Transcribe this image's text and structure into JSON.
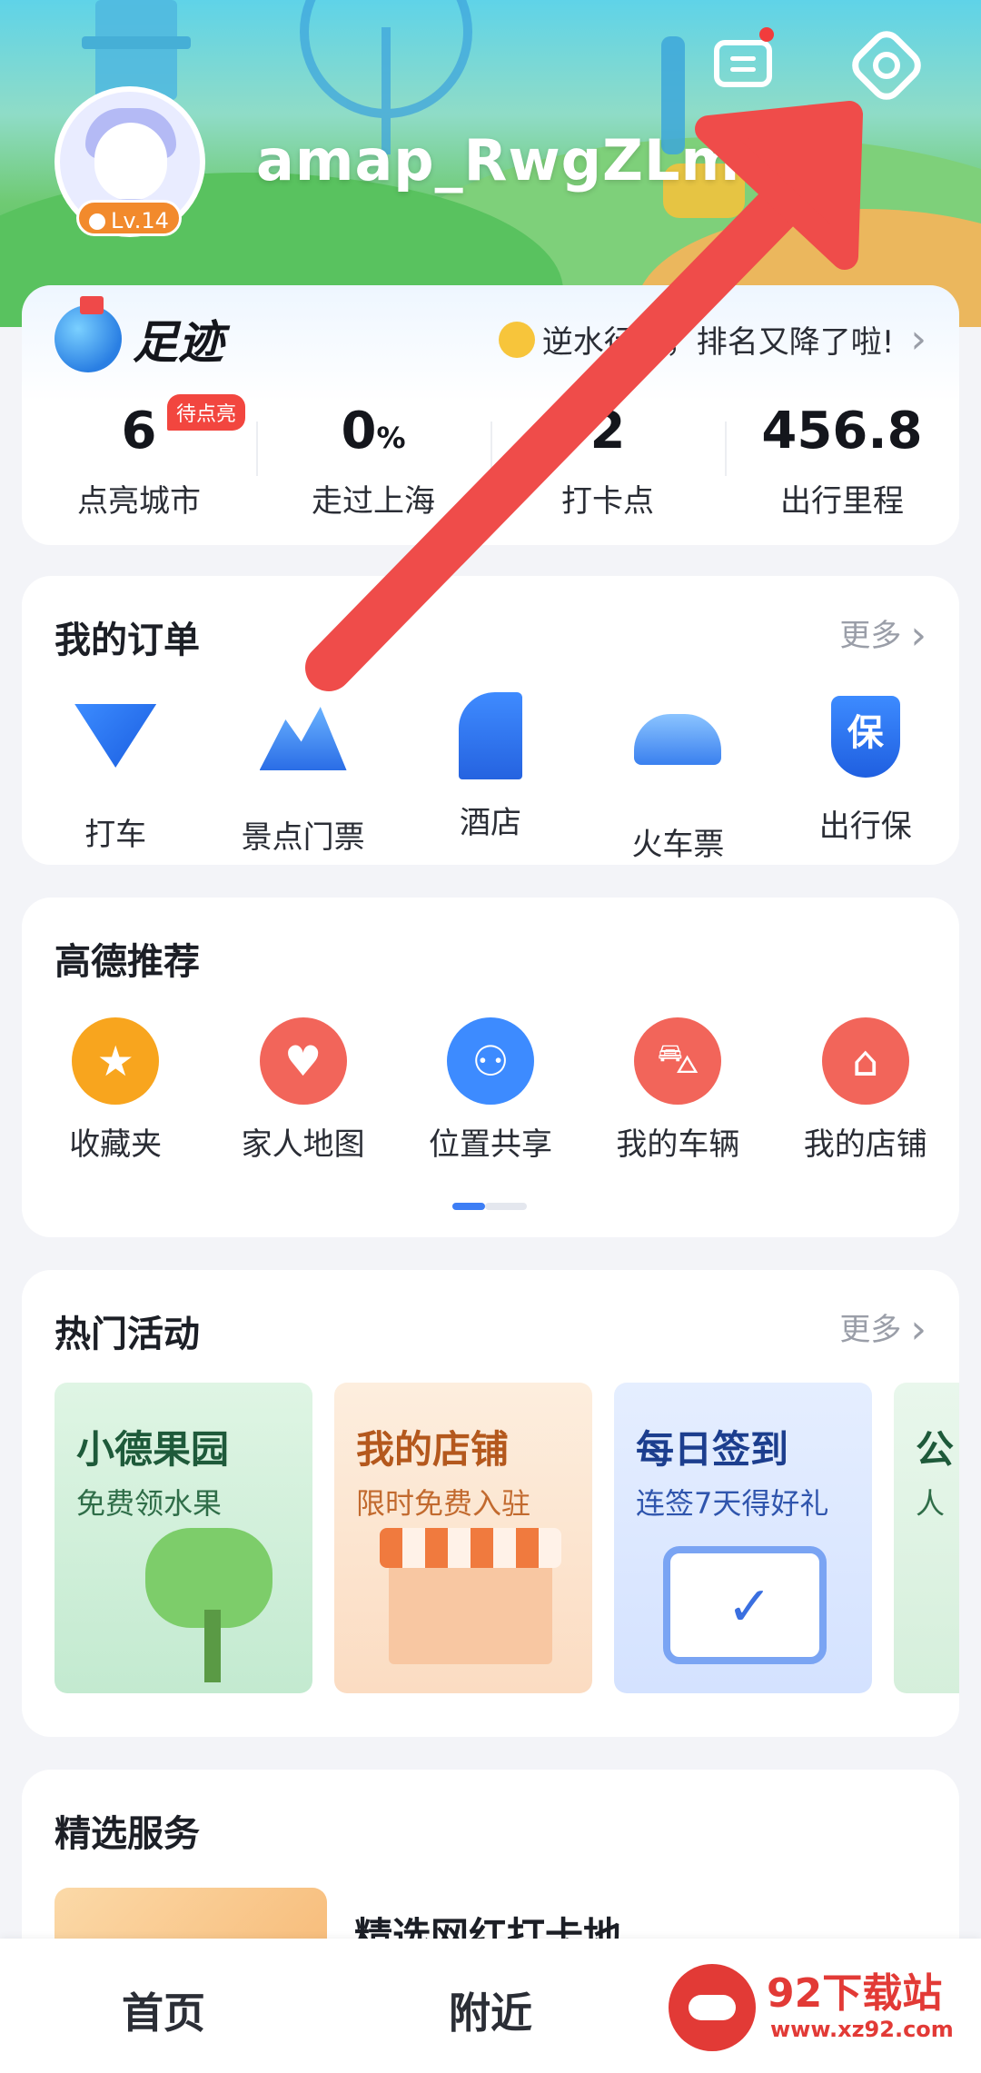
{
  "header": {
    "username": "amap_RwgZLme",
    "level": "Lv.14"
  },
  "footprint": {
    "title": "足迹",
    "notice": "逆水行舟，排名又降了啦!",
    "stats": [
      {
        "value": "6",
        "unit": "",
        "label": "点亮城市",
        "badge": "待点亮"
      },
      {
        "value": "0",
        "unit": "%",
        "label": "走过上海",
        "badge": ""
      },
      {
        "value": "2",
        "unit": "",
        "label": "打卡点",
        "badge": ""
      },
      {
        "value": "456.8",
        "unit": "",
        "label": "出行里程",
        "badge": ""
      }
    ]
  },
  "orders": {
    "title": "我的订单",
    "more": "更多",
    "items": [
      {
        "label": "打车",
        "icon": "taxi-icon"
      },
      {
        "label": "景点门票",
        "icon": "scenic-ticket-icon"
      },
      {
        "label": "酒店",
        "icon": "hotel-icon"
      },
      {
        "label": "火车票",
        "icon": "train-icon"
      },
      {
        "label": "出行保",
        "icon": "insurance-shield-icon",
        "glyph": "保"
      }
    ]
  },
  "recommend": {
    "title": "高德推荐",
    "items": [
      {
        "label": "收藏夹",
        "icon": "star-icon",
        "glyph": "★"
      },
      {
        "label": "家人地图",
        "icon": "family-map-icon",
        "glyph": "♥"
      },
      {
        "label": "位置共享",
        "icon": "location-share-icon",
        "glyph": "⚇"
      },
      {
        "label": "我的车辆",
        "icon": "vehicle-icon",
        "glyph": "⛍"
      },
      {
        "label": "我的店铺",
        "icon": "shop-icon",
        "glyph": "⌂"
      }
    ]
  },
  "activities": {
    "title": "热门活动",
    "more": "更多",
    "tiles": [
      {
        "title": "小德果园",
        "subtitle": "免费领水果"
      },
      {
        "title": "我的店铺",
        "subtitle": "限时免费入驻"
      },
      {
        "title": "每日签到",
        "subtitle": "连签7天得好礼"
      },
      {
        "title": "公",
        "subtitle": "人"
      }
    ]
  },
  "services": {
    "title": "精选服务",
    "item_title": "精选网红打卡地"
  },
  "nav": {
    "home": "首页",
    "nearby": "附近"
  },
  "watermark": {
    "name": "92下载站",
    "url": "www.xz92.com"
  },
  "colors": {
    "accent_blue": "#3d7ef5",
    "arrow_red": "#ef4c4a",
    "badge_red": "#f2463f"
  }
}
